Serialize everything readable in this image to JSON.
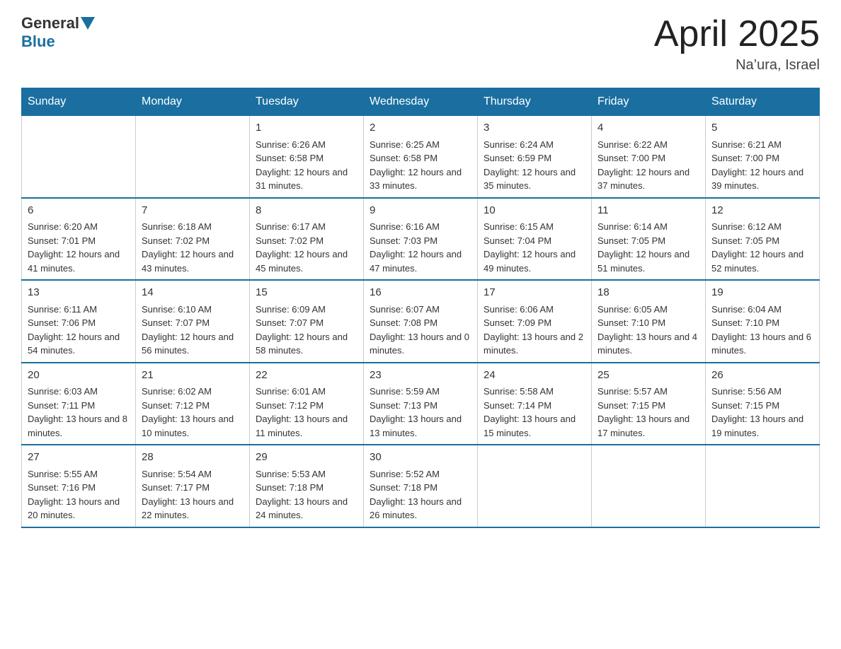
{
  "header": {
    "logo_general": "General",
    "logo_blue": "Blue",
    "month_title": "April 2025",
    "location": "Na’ura, Israel"
  },
  "days_of_week": [
    "Sunday",
    "Monday",
    "Tuesday",
    "Wednesday",
    "Thursday",
    "Friday",
    "Saturday"
  ],
  "weeks": [
    [
      {
        "day": "",
        "sunrise": "",
        "sunset": "",
        "daylight": ""
      },
      {
        "day": "",
        "sunrise": "",
        "sunset": "",
        "daylight": ""
      },
      {
        "day": "1",
        "sunrise": "Sunrise: 6:26 AM",
        "sunset": "Sunset: 6:58 PM",
        "daylight": "Daylight: 12 hours and 31 minutes."
      },
      {
        "day": "2",
        "sunrise": "Sunrise: 6:25 AM",
        "sunset": "Sunset: 6:58 PM",
        "daylight": "Daylight: 12 hours and 33 minutes."
      },
      {
        "day": "3",
        "sunrise": "Sunrise: 6:24 AM",
        "sunset": "Sunset: 6:59 PM",
        "daylight": "Daylight: 12 hours and 35 minutes."
      },
      {
        "day": "4",
        "sunrise": "Sunrise: 6:22 AM",
        "sunset": "Sunset: 7:00 PM",
        "daylight": "Daylight: 12 hours and 37 minutes."
      },
      {
        "day": "5",
        "sunrise": "Sunrise: 6:21 AM",
        "sunset": "Sunset: 7:00 PM",
        "daylight": "Daylight: 12 hours and 39 minutes."
      }
    ],
    [
      {
        "day": "6",
        "sunrise": "Sunrise: 6:20 AM",
        "sunset": "Sunset: 7:01 PM",
        "daylight": "Daylight: 12 hours and 41 minutes."
      },
      {
        "day": "7",
        "sunrise": "Sunrise: 6:18 AM",
        "sunset": "Sunset: 7:02 PM",
        "daylight": "Daylight: 12 hours and 43 minutes."
      },
      {
        "day": "8",
        "sunrise": "Sunrise: 6:17 AM",
        "sunset": "Sunset: 7:02 PM",
        "daylight": "Daylight: 12 hours and 45 minutes."
      },
      {
        "day": "9",
        "sunrise": "Sunrise: 6:16 AM",
        "sunset": "Sunset: 7:03 PM",
        "daylight": "Daylight: 12 hours and 47 minutes."
      },
      {
        "day": "10",
        "sunrise": "Sunrise: 6:15 AM",
        "sunset": "Sunset: 7:04 PM",
        "daylight": "Daylight: 12 hours and 49 minutes."
      },
      {
        "day": "11",
        "sunrise": "Sunrise: 6:14 AM",
        "sunset": "Sunset: 7:05 PM",
        "daylight": "Daylight: 12 hours and 51 minutes."
      },
      {
        "day": "12",
        "sunrise": "Sunrise: 6:12 AM",
        "sunset": "Sunset: 7:05 PM",
        "daylight": "Daylight: 12 hours and 52 minutes."
      }
    ],
    [
      {
        "day": "13",
        "sunrise": "Sunrise: 6:11 AM",
        "sunset": "Sunset: 7:06 PM",
        "daylight": "Daylight: 12 hours and 54 minutes."
      },
      {
        "day": "14",
        "sunrise": "Sunrise: 6:10 AM",
        "sunset": "Sunset: 7:07 PM",
        "daylight": "Daylight: 12 hours and 56 minutes."
      },
      {
        "day": "15",
        "sunrise": "Sunrise: 6:09 AM",
        "sunset": "Sunset: 7:07 PM",
        "daylight": "Daylight: 12 hours and 58 minutes."
      },
      {
        "day": "16",
        "sunrise": "Sunrise: 6:07 AM",
        "sunset": "Sunset: 7:08 PM",
        "daylight": "Daylight: 13 hours and 0 minutes."
      },
      {
        "day": "17",
        "sunrise": "Sunrise: 6:06 AM",
        "sunset": "Sunset: 7:09 PM",
        "daylight": "Daylight: 13 hours and 2 minutes."
      },
      {
        "day": "18",
        "sunrise": "Sunrise: 6:05 AM",
        "sunset": "Sunset: 7:10 PM",
        "daylight": "Daylight: 13 hours and 4 minutes."
      },
      {
        "day": "19",
        "sunrise": "Sunrise: 6:04 AM",
        "sunset": "Sunset: 7:10 PM",
        "daylight": "Daylight: 13 hours and 6 minutes."
      }
    ],
    [
      {
        "day": "20",
        "sunrise": "Sunrise: 6:03 AM",
        "sunset": "Sunset: 7:11 PM",
        "daylight": "Daylight: 13 hours and 8 minutes."
      },
      {
        "day": "21",
        "sunrise": "Sunrise: 6:02 AM",
        "sunset": "Sunset: 7:12 PM",
        "daylight": "Daylight: 13 hours and 10 minutes."
      },
      {
        "day": "22",
        "sunrise": "Sunrise: 6:01 AM",
        "sunset": "Sunset: 7:12 PM",
        "daylight": "Daylight: 13 hours and 11 minutes."
      },
      {
        "day": "23",
        "sunrise": "Sunrise: 5:59 AM",
        "sunset": "Sunset: 7:13 PM",
        "daylight": "Daylight: 13 hours and 13 minutes."
      },
      {
        "day": "24",
        "sunrise": "Sunrise: 5:58 AM",
        "sunset": "Sunset: 7:14 PM",
        "daylight": "Daylight: 13 hours and 15 minutes."
      },
      {
        "day": "25",
        "sunrise": "Sunrise: 5:57 AM",
        "sunset": "Sunset: 7:15 PM",
        "daylight": "Daylight: 13 hours and 17 minutes."
      },
      {
        "day": "26",
        "sunrise": "Sunrise: 5:56 AM",
        "sunset": "Sunset: 7:15 PM",
        "daylight": "Daylight: 13 hours and 19 minutes."
      }
    ],
    [
      {
        "day": "27",
        "sunrise": "Sunrise: 5:55 AM",
        "sunset": "Sunset: 7:16 PM",
        "daylight": "Daylight: 13 hours and 20 minutes."
      },
      {
        "day": "28",
        "sunrise": "Sunrise: 5:54 AM",
        "sunset": "Sunset: 7:17 PM",
        "daylight": "Daylight: 13 hours and 22 minutes."
      },
      {
        "day": "29",
        "sunrise": "Sunrise: 5:53 AM",
        "sunset": "Sunset: 7:18 PM",
        "daylight": "Daylight: 13 hours and 24 minutes."
      },
      {
        "day": "30",
        "sunrise": "Sunrise: 5:52 AM",
        "sunset": "Sunset: 7:18 PM",
        "daylight": "Daylight: 13 hours and 26 minutes."
      },
      {
        "day": "",
        "sunrise": "",
        "sunset": "",
        "daylight": ""
      },
      {
        "day": "",
        "sunrise": "",
        "sunset": "",
        "daylight": ""
      },
      {
        "day": "",
        "sunrise": "",
        "sunset": "",
        "daylight": ""
      }
    ]
  ]
}
